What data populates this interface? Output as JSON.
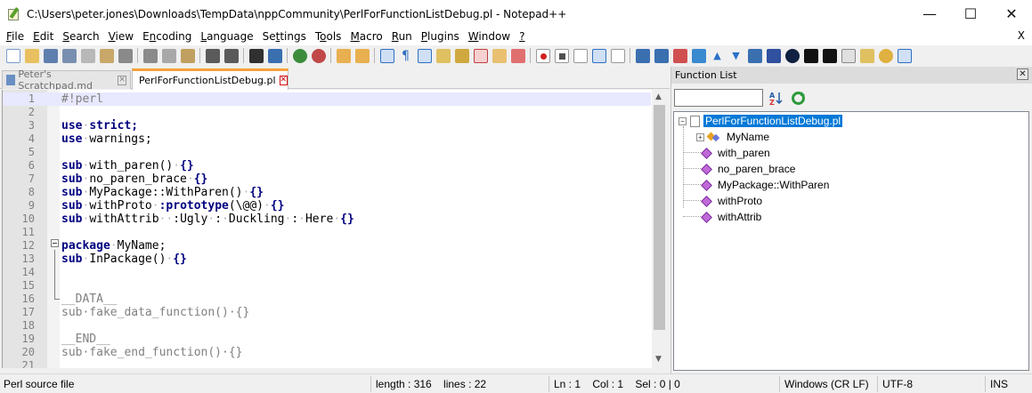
{
  "window": {
    "title": "C:\\Users\\peter.jones\\Downloads\\TempData\\nppCommunity\\PerlForFunctionListDebug.pl - Notepad++",
    "minimize": "—",
    "maximize": "☐",
    "close": "✕"
  },
  "menu": {
    "items": [
      {
        "label": "File",
        "underline": "F",
        "rest": "ile"
      },
      {
        "label": "Edit",
        "underline": "E",
        "rest": "dit"
      },
      {
        "label": "Search",
        "underline": "S",
        "rest": "earch"
      },
      {
        "label": "View",
        "underline": "V",
        "rest": "iew"
      },
      {
        "label": "Encoding",
        "underline": "n",
        "pre": "E",
        "rest": "coding"
      },
      {
        "label": "Language",
        "underline": "L",
        "rest": "anguage"
      },
      {
        "label": "Settings",
        "underline": "t",
        "pre": "Se",
        "rest": "tings"
      },
      {
        "label": "Tools",
        "underline": "o",
        "pre": "T",
        "rest": "ols"
      },
      {
        "label": "Macro",
        "underline": "M",
        "rest": "acro"
      },
      {
        "label": "Run",
        "underline": "R",
        "rest": "un"
      },
      {
        "label": "Plugins",
        "underline": "P",
        "rest": "lugins"
      },
      {
        "label": "Window",
        "underline": "W",
        "rest": "indow"
      },
      {
        "label": "?",
        "underline": "?",
        "rest": ""
      }
    ],
    "close_doc": "X"
  },
  "toolbar": {
    "colors": {
      "new": "#4a90d9",
      "open": "#e0b040",
      "save": "#5078b0",
      "save_all": "#5078b0",
      "close": "#909090",
      "close_all": "#909090",
      "print": "#707070",
      "cut": "#707070",
      "copy": "#8c8c8c",
      "paste": "#b08a40",
      "undo": "#404040",
      "redo": "#404040",
      "find": "#404040",
      "replace": "#3070c0",
      "zoom_in": "#3a8a3a",
      "zoom_out": "#c04040",
      "sync_v": "#e0a040",
      "sync_h": "#e0a040",
      "wrap": "#3070c0",
      "all_chars": "#3070c0",
      "indent_guide": "#3070c0",
      "udl": "#e0b040",
      "doc_map": "#d0a030",
      "func_list": "#c04040",
      "folder_ws": "#e0b040",
      "monitor": "#d04040",
      "rec": "#d02020",
      "stop": "#404040",
      "play": "#404040",
      "play_multi": "#3070c0",
      "save_macro": "#3070c0"
    }
  },
  "tabs": [
    {
      "label": "Peter's Scratchpad.md",
      "close": "✕"
    },
    {
      "label": "PerlForFunctionListDebug.pl",
      "close": "✕"
    }
  ],
  "editor": {
    "lines": [
      {
        "n": "1",
        "html": "<span class=\"dim\">#!perl</span>"
      },
      {
        "n": "2",
        "html": ""
      },
      {
        "n": "3",
        "html": "<span class=\"kw\">use</span><span class=\"dot\">·</span><span class=\"kw\">strict</span><span class=\"kw\">;</span>"
      },
      {
        "n": "4",
        "html": "<span class=\"kw\">use</span><span class=\"dot\">·</span>warnings;"
      },
      {
        "n": "5",
        "html": ""
      },
      {
        "n": "6",
        "html": "<span class=\"kw\">sub</span><span class=\"dot\">·</span>with_paren()<span class=\"dot\">·</span><span class=\"kw\">{}</span>"
      },
      {
        "n": "7",
        "html": "<span class=\"kw\">sub</span><span class=\"dot\">·</span>no_paren_brace<span class=\"dot\">·</span><span class=\"kw\">{}</span>"
      },
      {
        "n": "8",
        "html": "<span class=\"kw\">sub</span><span class=\"dot\">·</span>MyPackage::WithParen()<span class=\"dot\">·</span><span class=\"kw\">{}</span>"
      },
      {
        "n": "9",
        "html": "<span class=\"kw\">sub</span><span class=\"dot\">·</span>withProto<span class=\"dot\">·</span><span class=\"kw\">:prototype</span>(\\@@)<span class=\"dot\">·</span><span class=\"kw\">{}</span>"
      },
      {
        "n": "10",
        "html": "<span class=\"kw\">sub</span><span class=\"dot\">·</span>withAttrib<span class=\"dot\">·</span><span class=\"dot\">·</span>:Ugly<span class=\"dot\">·</span>:<span class=\"dot\">·</span>Duckling<span class=\"dot\">·</span>:<span class=\"dot\">·</span>Here<span class=\"dot\">·</span><span class=\"kw\">{}</span>"
      },
      {
        "n": "11",
        "html": ""
      },
      {
        "n": "12",
        "html": "<span class=\"kw\">package</span><span class=\"dot\">·</span>MyName;"
      },
      {
        "n": "13",
        "html": "<span class=\"kw\">sub</span><span class=\"dot\">·</span>InPackage()<span class=\"dot\">·</span><span class=\"kw\">{}</span>"
      },
      {
        "n": "14",
        "html": ""
      },
      {
        "n": "15",
        "html": ""
      },
      {
        "n": "16",
        "html": "<span class=\"dim\">__DATA__</span>"
      },
      {
        "n": "17",
        "html": "<span class=\"dim\">sub·fake_data_function()·{}</span>"
      },
      {
        "n": "18",
        "html": ""
      },
      {
        "n": "19",
        "html": "<span class=\"dim\">__END__</span>"
      },
      {
        "n": "20",
        "html": "<span class=\"dim\">sub·fake_end_function()·{}</span>"
      },
      {
        "n": "21",
        "html": ""
      }
    ]
  },
  "function_list": {
    "title": "Function List",
    "close": "✕",
    "search_placeholder": "",
    "root": "PerlForFunctionListDebug.pl",
    "items": [
      {
        "label": "MyName",
        "expandable": true
      },
      {
        "label": "with_paren"
      },
      {
        "label": "no_paren_brace"
      },
      {
        "label": "MyPackage::WithParen"
      },
      {
        "label": "withProto"
      },
      {
        "label": "withAttrib"
      }
    ]
  },
  "statusbar": {
    "filetype": "Perl source file",
    "length": "length : 316    lines : 22",
    "position": "Ln : 1    Col : 1    Sel : 0 | 0",
    "eol": "Windows (CR LF)",
    "encoding": "UTF-8",
    "mode": "INS"
  }
}
